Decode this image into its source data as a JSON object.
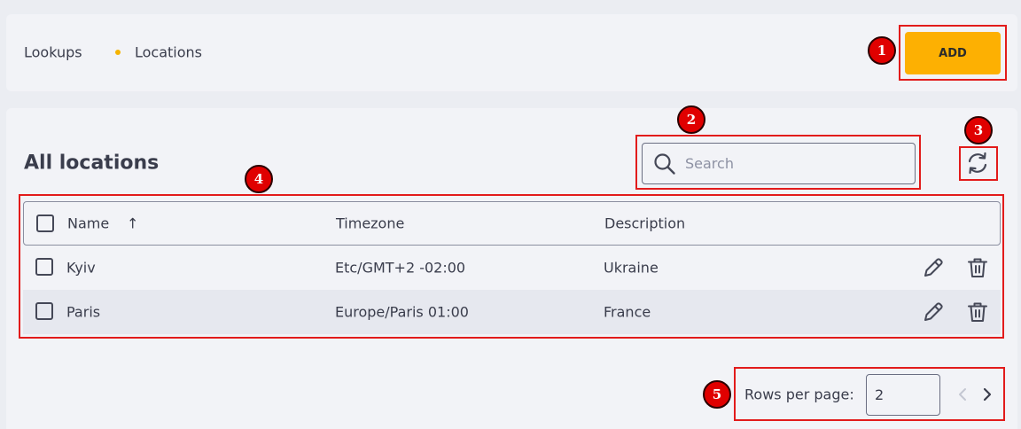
{
  "breadcrumb": {
    "items": [
      "Lookups",
      "Locations"
    ]
  },
  "header": {
    "add_label": "ADD"
  },
  "main": {
    "title": "All locations",
    "search_placeholder": "Search",
    "search_value": ""
  },
  "table": {
    "columns": [
      "Name",
      "Timezone",
      "Description"
    ],
    "sort_indicator": "↑",
    "rows": [
      {
        "name": "Kyiv",
        "timezone": "Etc/GMT+2 -02:00",
        "description": "Ukraine"
      },
      {
        "name": "Paris",
        "timezone": "Europe/Paris 01:00",
        "description": "France"
      }
    ]
  },
  "pagination": {
    "rows_per_page_label": "Rows per page:",
    "rows_per_page_value": "2"
  },
  "annotations": [
    "1",
    "2",
    "3",
    "4",
    "5"
  ],
  "colors": {
    "accent": "#fdb002",
    "annotation": "#e21b1b",
    "text": "#3a3d4c",
    "panel": "#f2f3f7"
  },
  "icons": [
    "search-icon",
    "refresh-icon",
    "edit-icon",
    "delete-icon",
    "chevron-left-icon",
    "chevron-right-icon"
  ]
}
